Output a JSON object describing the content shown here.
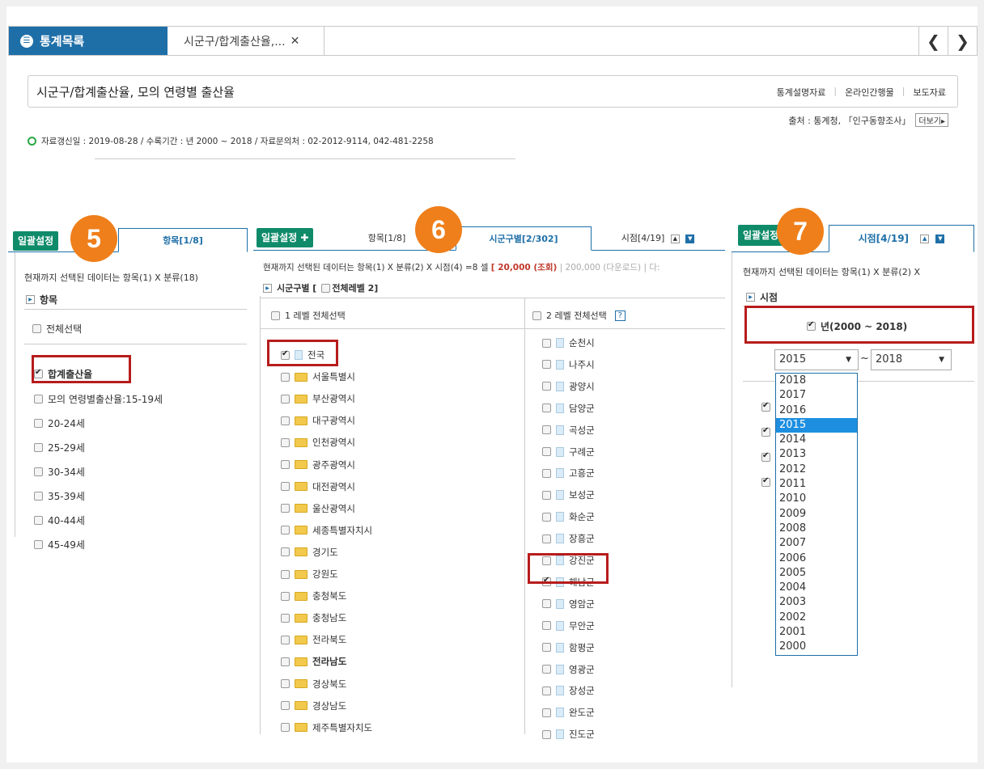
{
  "tabbar": {
    "main_label": "통계목록",
    "doc_tab": "시군구/합계출산율,...",
    "close": "✕",
    "prev": "❮",
    "next": "❯"
  },
  "header": {
    "title": "시군구/합계출산율, 모의 연령별 출산율",
    "links": [
      "통계설명자료",
      "온라인간행물",
      "보도자료"
    ],
    "source": "출처 : 통계청, 「인구동향조사」",
    "more": "더보기▸",
    "update": "자료갱신일 : 2019-08-28 / 수록기간 : 년 2000 ~ 2018 / 자료문의처 : 02-2012-9114, 042-481-2258"
  },
  "panel1": {
    "btn": "일괄설정",
    "badge": "5",
    "tab": "항목[1/8]",
    "info": "현재까지 선택된 데이터는 항목(1) X 분류(18)",
    "section": "항목",
    "select_all": "전체선택",
    "items": [
      {
        "label": "합계출산율",
        "checked": true
      },
      {
        "label": "모의 연령별출산율:15-19세",
        "checked": false
      },
      {
        "label": "20-24세",
        "checked": false
      },
      {
        "label": "25-29세",
        "checked": false
      },
      {
        "label": "30-34세",
        "checked": false
      },
      {
        "label": "35-39세",
        "checked": false
      },
      {
        "label": "40-44세",
        "checked": false
      },
      {
        "label": "45-49세",
        "checked": false
      }
    ]
  },
  "panel2": {
    "btn": "일괄설정 ✚",
    "badge": "6",
    "tab_item": "항목[1/8]",
    "tab_region": "시군구별[2/302]",
    "tab_time": "시점[4/19]",
    "info": "현재까지 선택된 데이터는 항목(1) X 분류(2) X 시점(4) =8 셀",
    "info_limit": "[ 20,000 (조회)",
    "info_dl": "| 200,000 (다운로드) | 다:",
    "section": "시군구별 [",
    "section2": "전체레벨 2]",
    "level1_all": "1 레벨 전체선택",
    "level2_all": "2 레벨 전체선택",
    "help": "?",
    "level1": [
      {
        "label": "전국",
        "checked": true,
        "icon": "page"
      },
      {
        "label": "서울특별시",
        "checked": false,
        "icon": "folder"
      },
      {
        "label": "부산광역시",
        "checked": false,
        "icon": "folder"
      },
      {
        "label": "대구광역시",
        "checked": false,
        "icon": "folder"
      },
      {
        "label": "인천광역시",
        "checked": false,
        "icon": "folder"
      },
      {
        "label": "광주광역시",
        "checked": false,
        "icon": "folder"
      },
      {
        "label": "대전광역시",
        "checked": false,
        "icon": "folder"
      },
      {
        "label": "울산광역시",
        "checked": false,
        "icon": "folder"
      },
      {
        "label": "세종특별자치시",
        "checked": false,
        "icon": "folder"
      },
      {
        "label": "경기도",
        "checked": false,
        "icon": "folder"
      },
      {
        "label": "강원도",
        "checked": false,
        "icon": "folder"
      },
      {
        "label": "충청북도",
        "checked": false,
        "icon": "folder"
      },
      {
        "label": "충청남도",
        "checked": false,
        "icon": "folder"
      },
      {
        "label": "전라북도",
        "checked": false,
        "icon": "folder"
      },
      {
        "label": "전라남도",
        "checked": false,
        "icon": "folder",
        "bold": true
      },
      {
        "label": "경상북도",
        "checked": false,
        "icon": "folder"
      },
      {
        "label": "경상남도",
        "checked": false,
        "icon": "folder"
      },
      {
        "label": "제주특별자치도",
        "checked": false,
        "icon": "folder"
      }
    ],
    "level2": [
      {
        "label": "순천시",
        "checked": false
      },
      {
        "label": "나주시",
        "checked": false
      },
      {
        "label": "광양시",
        "checked": false
      },
      {
        "label": "담양군",
        "checked": false
      },
      {
        "label": "곡성군",
        "checked": false
      },
      {
        "label": "구례군",
        "checked": false
      },
      {
        "label": "고흥군",
        "checked": false
      },
      {
        "label": "보성군",
        "checked": false
      },
      {
        "label": "화순군",
        "checked": false
      },
      {
        "label": "장흥군",
        "checked": false
      },
      {
        "label": "강진군",
        "checked": false
      },
      {
        "label": "해남군",
        "checked": true
      },
      {
        "label": "영암군",
        "checked": false
      },
      {
        "label": "무안군",
        "checked": false
      },
      {
        "label": "함평군",
        "checked": false
      },
      {
        "label": "영광군",
        "checked": false
      },
      {
        "label": "장성군",
        "checked": false
      },
      {
        "label": "완도군",
        "checked": false
      },
      {
        "label": "진도군",
        "checked": false
      }
    ]
  },
  "panel3": {
    "btn": "일괄설정",
    "badge": "7",
    "tab": "시점[4/19]",
    "info": "현재까지 선택된 데이터는 항목(1) X 분류(2) X",
    "section": "시점",
    "year_label": "년(2000 ~ 2018)",
    "from": "2015",
    "tilde": "~",
    "to": "2018",
    "years": [
      "2018",
      "2017",
      "2016",
      "2015",
      "2014",
      "2013",
      "2012",
      "2011",
      "2010",
      "2009",
      "2008",
      "2007",
      "2006",
      "2005",
      "2004",
      "2003",
      "2002",
      "2001",
      "2000"
    ],
    "selected_year": "2015",
    "accent": "#1e8fe0"
  },
  "colors": {
    "brand": "#1e6fa8",
    "green": "#0f8b6a",
    "badge": "#ef7f1a",
    "highlight": "#b71c1c"
  }
}
